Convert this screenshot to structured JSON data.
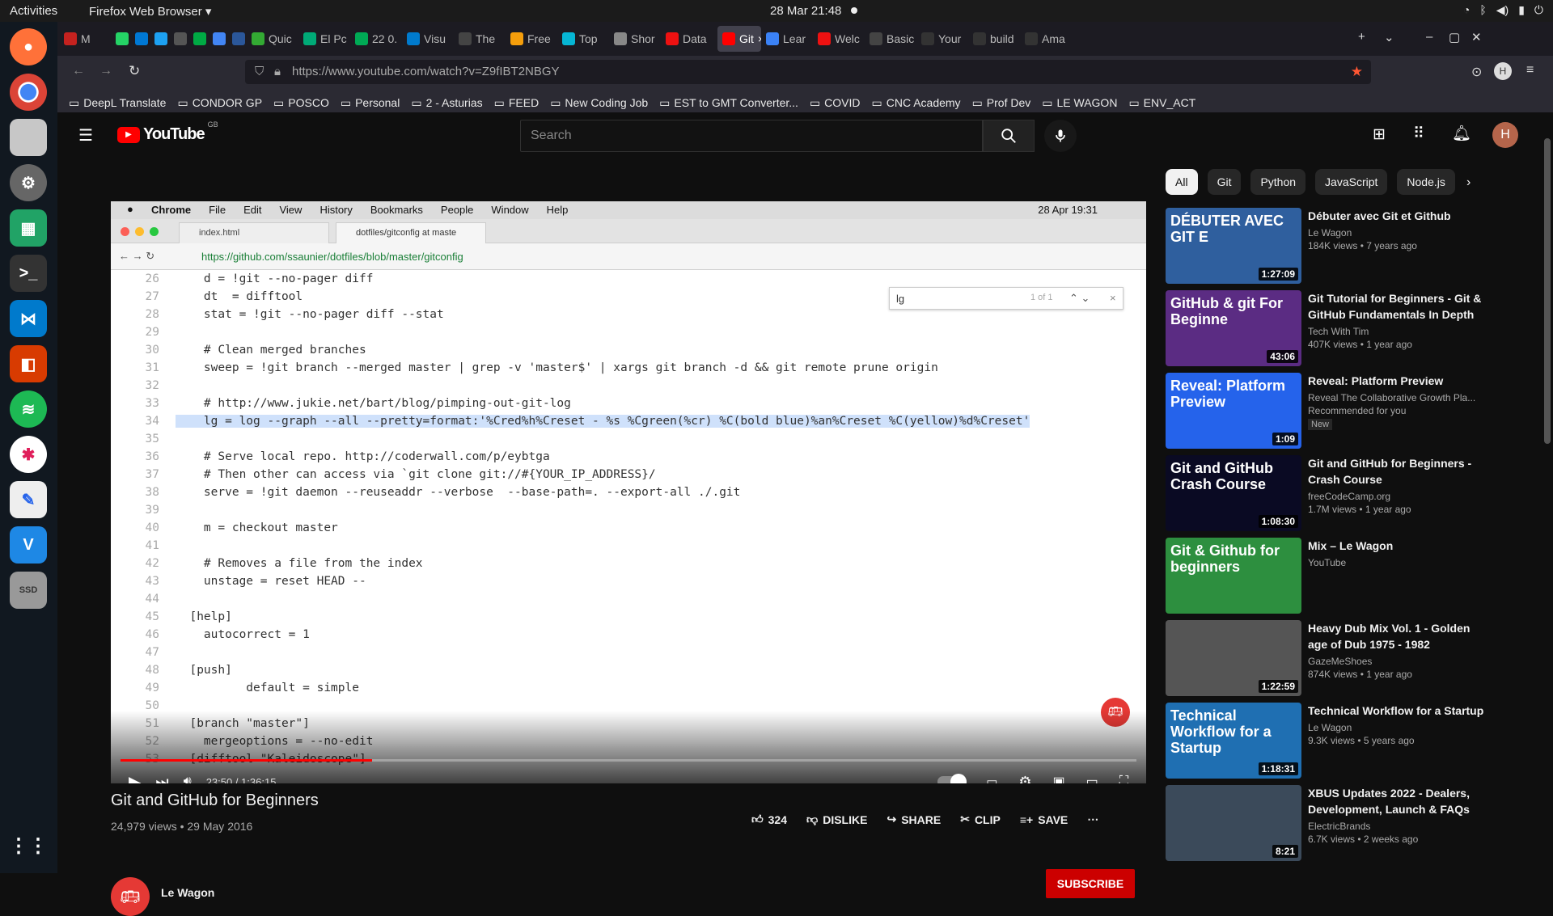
{
  "topbar": {
    "activities": "Activities",
    "app": "Firefox Web Browser ▾",
    "clock": "28 Mar  21:48"
  },
  "tabs": [
    {
      "label": "M",
      "color": "#c5221f"
    },
    {
      "label": "",
      "color": "#25d366"
    },
    {
      "label": "",
      "color": "#0078d4"
    },
    {
      "label": "",
      "color": "#1da1f2"
    },
    {
      "label": "",
      "color": "#555"
    },
    {
      "label": "",
      "color": "#0a4"
    },
    {
      "label": "",
      "color": "#4285f4"
    },
    {
      "label": "",
      "color": "#2b579a"
    },
    {
      "label": "Quic",
      "color": "#3a3"
    },
    {
      "label": "El Pc",
      "color": "#0a7"
    },
    {
      "label": "22 0.",
      "color": "#0a5"
    },
    {
      "label": "Visu",
      "color": "#007acc"
    },
    {
      "label": "The",
      "color": "#444"
    },
    {
      "label": "Free",
      "color": "#f59e0b"
    },
    {
      "label": "Top",
      "color": "#06b6d4"
    },
    {
      "label": "Shor",
      "color": "#888"
    },
    {
      "label": "Data",
      "color": "#e11"
    },
    {
      "label": "Git",
      "color": "#f00",
      "active": true
    },
    {
      "label": "Lear",
      "color": "#3b82f6"
    },
    {
      "label": "Welc",
      "color": "#e11"
    },
    {
      "label": "Basic",
      "color": "#444"
    },
    {
      "label": "Your",
      "color": "#333"
    },
    {
      "label": "build",
      "color": "#333"
    },
    {
      "label": "Ama",
      "color": "#333"
    }
  ],
  "url": "https://www.youtube.com/watch?v=Z9fIBT2NBGY",
  "bookmarks": [
    "DeepL Translate",
    "CONDOR GP",
    "POSCO",
    "Personal",
    "2 - Asturias",
    "FEED",
    "New Coding Job",
    "EST to GMT Converter...",
    "COVID",
    "CNC Academy",
    "Prof Dev",
    "LE WAGON",
    "ENV_ACT"
  ],
  "yt": {
    "logo": "YouTube",
    "region": "GB",
    "search_placeholder": "Search",
    "avatar": "H"
  },
  "video": {
    "mac_menu": [
      "Chrome",
      "File",
      "Edit",
      "View",
      "History",
      "Bookmarks",
      "People",
      "Window",
      "Help"
    ],
    "mac_clock": "28 Apr  19:31",
    "chrome_tabs": [
      "index.html",
      "dotfiles/gitconfig at maste"
    ],
    "chrome_url": "https://github.com/ssaunier/dotfiles/blob/master/gitconfig",
    "find": {
      "query": "lg",
      "count": "1 of 1"
    },
    "lines": [
      {
        "n": "26",
        "t": "    d = !git --no-pager diff"
      },
      {
        "n": "27",
        "t": "    dt  = difftool"
      },
      {
        "n": "28",
        "t": "    stat = !git --no-pager diff --stat"
      },
      {
        "n": "29",
        "t": ""
      },
      {
        "n": "30",
        "t": "    # Clean merged branches"
      },
      {
        "n": "31",
        "t": "    sweep = !git branch --merged master | grep -v 'master$' | xargs git branch -d && git remote prune origin"
      },
      {
        "n": "32",
        "t": ""
      },
      {
        "n": "33",
        "t": "    # http://www.jukie.net/bart/blog/pimping-out-git-log"
      },
      {
        "n": "34",
        "t": "    lg = log --graph --all --pretty=format:'%Cred%h%Creset - %s %Cgreen(%cr) %C(bold blue)%an%Creset %C(yellow)%d%Creset'",
        "hl": true
      },
      {
        "n": "35",
        "t": ""
      },
      {
        "n": "36",
        "t": "    # Serve local repo. http://coderwall.com/p/eybtga"
      },
      {
        "n": "37",
        "t": "    # Then other can access via `git clone git://#{YOUR_IP_ADDRESS}/"
      },
      {
        "n": "38",
        "t": "    serve = !git daemon --reuseaddr --verbose  --base-path=. --export-all ./.git"
      },
      {
        "n": "39",
        "t": ""
      },
      {
        "n": "40",
        "t": "    m = checkout master"
      },
      {
        "n": "41",
        "t": ""
      },
      {
        "n": "42",
        "t": "    # Removes a file from the index"
      },
      {
        "n": "43",
        "t": "    unstage = reset HEAD --"
      },
      {
        "n": "44",
        "t": ""
      },
      {
        "n": "45",
        "t": "  [help]"
      },
      {
        "n": "46",
        "t": "    autocorrect = 1"
      },
      {
        "n": "47",
        "t": ""
      },
      {
        "n": "48",
        "t": "  [push]"
      },
      {
        "n": "49",
        "t": "          default = simple"
      },
      {
        "n": "50",
        "t": ""
      },
      {
        "n": "51",
        "t": "  [branch \"master\"]"
      },
      {
        "n": "52",
        "t": "    mergeoptions = --no-edit"
      },
      {
        "n": "53",
        "t": "  [difftool \"Kaleidoscope\"]"
      }
    ],
    "time": "23:50 / 1:36:15",
    "progress": 0.2478
  },
  "info": {
    "title": "Git and GitHub for Beginners",
    "meta": "24,979 views • 29 May 2016",
    "likes": "324",
    "dislike": "DISLIKE",
    "share": "SHARE",
    "clip": "CLIP",
    "save": "SAVE",
    "channel": "Le Wagon",
    "subscribe": "SUBSCRIBE"
  },
  "chips": [
    "All",
    "Git",
    "Python",
    "JavaScript",
    "Node.js"
  ],
  "recs": [
    {
      "title": "Débuter avec Git et Github",
      "channel": "Le Wagon",
      "meta": "184K views • 7 years ago",
      "duration": "1:27:09",
      "thumb_text": "DÉBUTER AVEC GIT E",
      "bg": "#2f5f9e"
    },
    {
      "title": "Git Tutorial for Beginners - Git & GitHub Fundamentals In Depth",
      "channel": "Tech With Tim",
      "meta": "407K views • 1 year ago",
      "duration": "43:06",
      "thumb_text": "GitHub & git  For Beginne",
      "bg": "#5b2c83"
    },
    {
      "title": "Reveal: Platform Preview",
      "channel": "Reveal The Collaborative Growth Pla...",
      "meta": "Recommended for you",
      "badge": "New",
      "duration": "1:09",
      "thumb_text": "Reveal: Platform Preview",
      "bg": "#2563eb"
    },
    {
      "title": "Git and GitHub for Beginners - Crash Course",
      "channel": "freeCodeCamp.org",
      "meta": "1.7M views • 1 year ago",
      "duration": "1:08:30",
      "thumb_text": "Git and GitHub Crash Course",
      "bg": "#0a0a23"
    },
    {
      "title": "Mix – Le Wagon",
      "channel": "YouTube",
      "meta": "",
      "duration": "",
      "thumb_text": "Git & Github for beginners",
      "bg": "#2d8f3f"
    },
    {
      "title": "Heavy Dub Mix Vol. 1 - Golden age of Dub 1975 - 1982",
      "channel": "GazeMeShoes",
      "meta": "874K views • 1 year ago",
      "duration": "1:22:59",
      "thumb_text": "",
      "bg": "#555"
    },
    {
      "title": "Technical Workflow for a Startup",
      "channel": "Le Wagon",
      "meta": "9.3K views • 5 years ago",
      "duration": "1:18:31",
      "thumb_text": "Technical Workflow for a Startup",
      "bg": "#1f6fb2"
    },
    {
      "title": "XBUS Updates 2022 - Dealers, Development, Launch & FAQs",
      "channel": "ElectricBrands",
      "meta": "6.7K views • 2 weeks ago",
      "duration": "8:21",
      "thumb_text": "",
      "bg": "#3b4a5a"
    }
  ]
}
